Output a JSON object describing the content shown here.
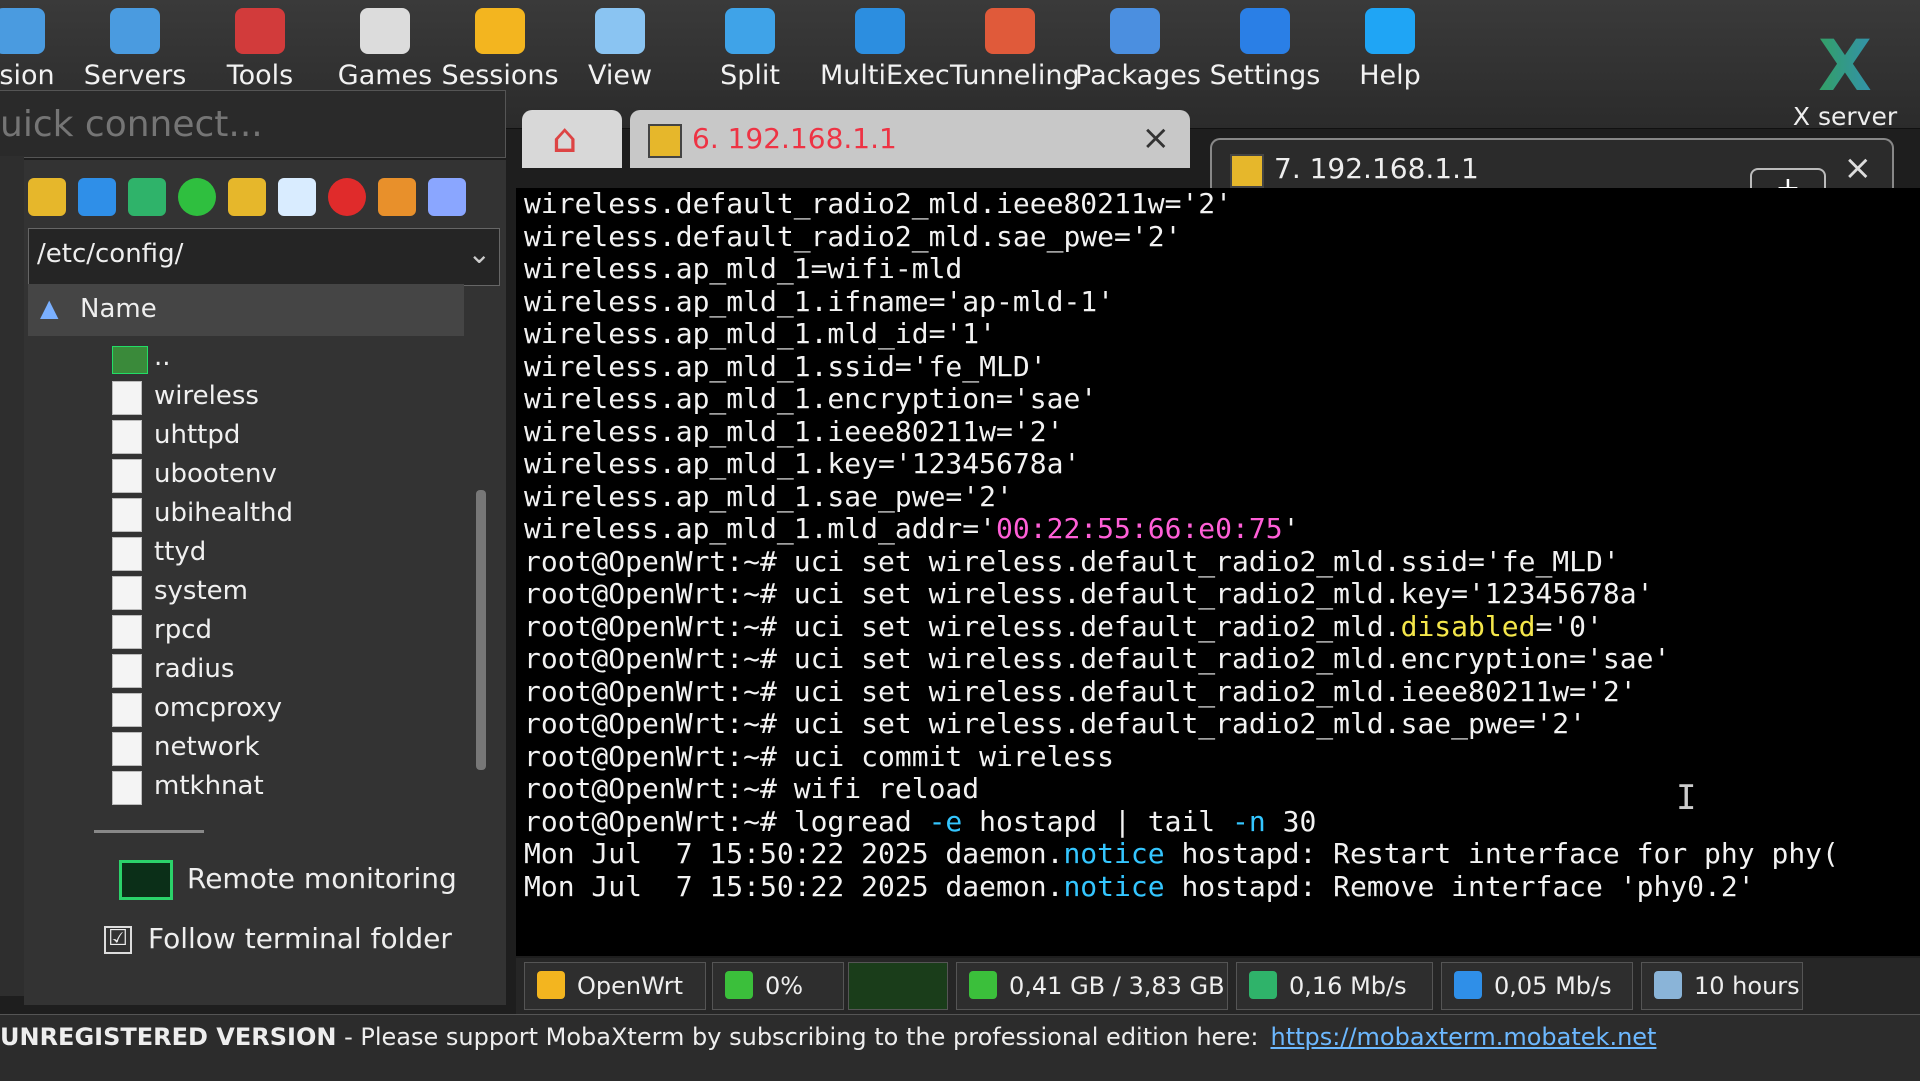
{
  "toolbar": {
    "buttons": [
      {
        "label": "ssion",
        "icon": "session-icon",
        "color": "#4a9be0"
      },
      {
        "label": "Servers",
        "icon": "servers-icon",
        "color": "#4a9be0"
      },
      {
        "label": "Tools",
        "icon": "tools-icon",
        "color": "#d23b3b"
      },
      {
        "label": "Games",
        "icon": "games-icon",
        "color": "#dcdcdc"
      },
      {
        "label": "Sessions",
        "icon": "star-icon",
        "color": "#f3b51f"
      },
      {
        "label": "View",
        "icon": "view-icon",
        "color": "#8ac4f2"
      },
      {
        "label": "Split",
        "icon": "split-icon",
        "color": "#3fa3e8"
      },
      {
        "label": "MultiExec",
        "icon": "multiexec-icon",
        "color": "#2c8ee0"
      },
      {
        "label": "Tunneling",
        "icon": "tunneling-icon",
        "color": "#e05a3a"
      },
      {
        "label": "Packages",
        "icon": "packages-icon",
        "color": "#4b8fe0"
      },
      {
        "label": "Settings",
        "icon": "gear-icon",
        "color": "#2a7fe6"
      },
      {
        "label": "Help",
        "icon": "help-icon",
        "color": "#1fa5f5"
      }
    ],
    "xserver_label": "X server"
  },
  "quick_connect": {
    "placeholder": "uick connect..."
  },
  "sidebar": {
    "path": "/etc/config/",
    "column_header": "Name",
    "files": [
      "..",
      "wireless",
      "uhttpd",
      "ubootenv",
      "ubihealthd",
      "ttyd",
      "system",
      "rpcd",
      "radius",
      "omcproxy",
      "network",
      "mtkhnat"
    ],
    "remote_monitoring": "Remote monitoring",
    "follow_terminal_folder": "Follow terminal folder",
    "follow_checked": "☑"
  },
  "tabs": {
    "tab1": "6. 192.168.1.1",
    "tab2": "7. 192.168.1.1",
    "close": "×",
    "new_tab": "+"
  },
  "terminal": {
    "lines": [
      [
        {
          "t": "wireless.default_radio2_mld.ieee80211w='2'"
        }
      ],
      [
        {
          "t": "wireless.default_radio2_mld.sae_pwe='2'"
        }
      ],
      [
        {
          "t": "wireless.ap_mld_1=wifi-mld"
        }
      ],
      [
        {
          "t": "wireless.ap_mld_1.ifname='ap-mld-1'"
        }
      ],
      [
        {
          "t": "wireless.ap_mld_1.mld_id='1'"
        }
      ],
      [
        {
          "t": "wireless.ap_mld_1.ssid='fe_MLD'"
        }
      ],
      [
        {
          "t": "wireless.ap_mld_1.encryption='sae'"
        }
      ],
      [
        {
          "t": "wireless.ap_mld_1.ieee80211w='2'"
        }
      ],
      [
        {
          "t": "wireless.ap_mld_1.key='12345678a'"
        }
      ],
      [
        {
          "t": "wireless.ap_mld_1.sae_pwe='2'"
        }
      ],
      [
        {
          "t": "wireless.ap_mld_1.mld_addr='"
        },
        {
          "t": "00:22:55:66:e0:75",
          "c": "mag"
        },
        {
          "t": "'"
        }
      ],
      [
        {
          "t": "root@OpenWrt:~# uci set wireless.default_radio2_mld.ssid='fe_MLD'"
        }
      ],
      [
        {
          "t": "root@OpenWrt:~# uci set wireless.default_radio2_mld.key='12345678a'"
        }
      ],
      [
        {
          "t": "root@OpenWrt:~# uci set wireless.default_radio2_mld."
        },
        {
          "t": "disabled",
          "c": "yel"
        },
        {
          "t": "='0'"
        }
      ],
      [
        {
          "t": "root@OpenWrt:~# uci set wireless.default_radio2_mld.encryption='sae'"
        }
      ],
      [
        {
          "t": "root@OpenWrt:~# uci set wireless.default_radio2_mld.ieee80211w='2'"
        }
      ],
      [
        {
          "t": "root@OpenWrt:~# uci set wireless.default_radio2_mld.sae_pwe='2'"
        }
      ],
      [
        {
          "t": "root@OpenWrt:~# uci commit wireless"
        }
      ],
      [
        {
          "t": "root@OpenWrt:~# wifi reload"
        }
      ],
      [
        {
          "t": "root@OpenWrt:~# logread "
        },
        {
          "t": "-e",
          "c": "blu"
        },
        {
          "t": " hostapd | tail "
        },
        {
          "t": "-n",
          "c": "blu"
        },
        {
          "t": " 30"
        }
      ],
      [
        {
          "t": "Mon Jul  7 15:50:22 2025 daemon."
        },
        {
          "t": "notice",
          "c": "blu"
        },
        {
          "t": " hostapd: Restart interface for phy phy("
        }
      ],
      [
        {
          "t": "Mon Jul  7 15:50:22 2025 daemon."
        },
        {
          "t": "notice",
          "c": "blu"
        },
        {
          "t": " hostapd: Remove interface 'phy0.2'"
        }
      ]
    ],
    "cursor": "I"
  },
  "status": {
    "host": "OpenWrt",
    "cpu": "0%",
    "memory": "0,41 GB / 3,83 GB",
    "upload": "0,16 Mb/s",
    "download": "0,05 Mb/s",
    "uptime": "10 hours"
  },
  "bottom": {
    "prefix": "UNREGISTERED VERSION",
    "message": "  -  Please support MobaXterm by subscribing to the professional edition here:",
    "link": "https://mobaxterm.mobatek.net"
  }
}
